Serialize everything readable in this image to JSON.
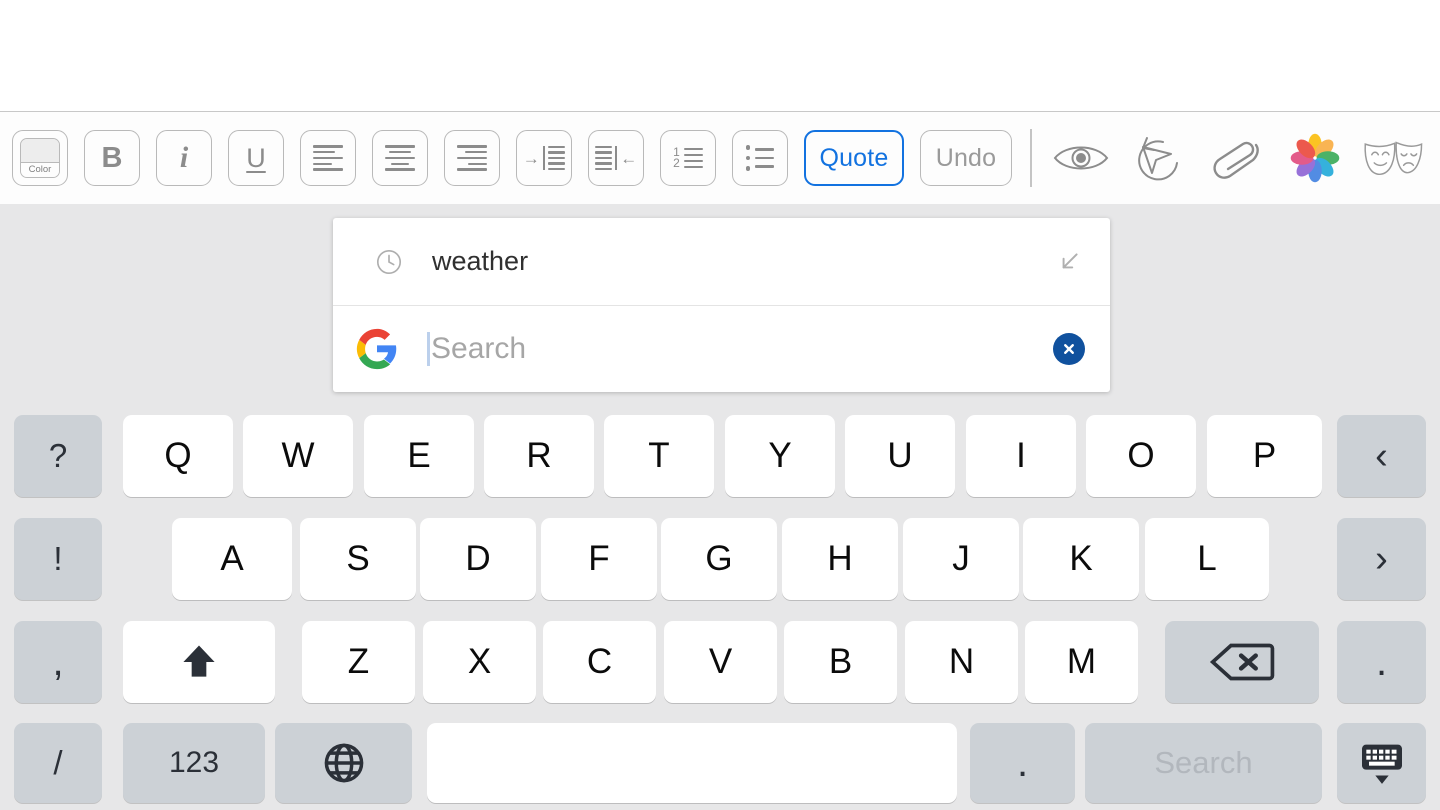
{
  "app": {
    "context": "ios-mail-compose-with-google-search-keyboard"
  },
  "compose": {
    "body_text": ""
  },
  "toolbar": {
    "color_button": {
      "label": "Color",
      "name": "color-picker"
    },
    "buttons": [
      {
        "id": "bold",
        "label": "B",
        "name": "bold-button"
      },
      {
        "id": "italic",
        "label": "i",
        "name": "italic-button"
      },
      {
        "id": "underline",
        "label": "U",
        "name": "underline-button"
      },
      {
        "id": "align-left",
        "label": "",
        "name": "align-left-button"
      },
      {
        "id": "align-center",
        "label": "",
        "name": "align-center-button"
      },
      {
        "id": "align-right",
        "label": "",
        "name": "align-right-button"
      },
      {
        "id": "indent",
        "label": "",
        "name": "indent-button"
      },
      {
        "id": "outdent",
        "label": "",
        "name": "outdent-button"
      },
      {
        "id": "numbered-list",
        "label": "1 2",
        "name": "numbered-list-button"
      },
      {
        "id": "bulleted-list",
        "label": "",
        "name": "bulleted-list-button"
      }
    ],
    "quote_label": "Quote",
    "undo_label": "Undo",
    "quote_accent_color": "#1272e0",
    "undo_color": "#9a9a9a",
    "icons": [
      {
        "id": "preview",
        "name": "eye-icon"
      },
      {
        "id": "undo-send",
        "name": "undo-send-icon"
      },
      {
        "id": "attach",
        "name": "paperclip-icon"
      },
      {
        "id": "photos",
        "name": "photos-app-icon"
      },
      {
        "id": "markup",
        "name": "theater-masks-icon"
      }
    ]
  },
  "search_popup": {
    "suggestion": {
      "text": "weather",
      "leading_icon": "clock-icon",
      "trailing_icon": "arrow-down-left-icon"
    },
    "search_field": {
      "value": "",
      "placeholder": "Search",
      "leading_icon": "google-g-icon",
      "clear_icon": "clear-circle-icon",
      "clear_color": "#10519e"
    }
  },
  "keyboard": {
    "row1": [
      {
        "label": "?",
        "name": "key-question-mark",
        "style": "alt"
      },
      {
        "label": "Q",
        "name": "key-q",
        "style": "letter"
      },
      {
        "label": "W",
        "name": "key-w",
        "style": "letter"
      },
      {
        "label": "E",
        "name": "key-e",
        "style": "letter"
      },
      {
        "label": "R",
        "name": "key-r",
        "style": "letter"
      },
      {
        "label": "T",
        "name": "key-t",
        "style": "letter"
      },
      {
        "label": "Y",
        "name": "key-y",
        "style": "letter"
      },
      {
        "label": "U",
        "name": "key-u",
        "style": "letter"
      },
      {
        "label": "I",
        "name": "key-i",
        "style": "letter"
      },
      {
        "label": "O",
        "name": "key-o",
        "style": "letter"
      },
      {
        "label": "P",
        "name": "key-p",
        "style": "letter"
      },
      {
        "label": "‹",
        "name": "key-chevron-left",
        "style": "alt"
      }
    ],
    "row2": [
      {
        "label": "!",
        "name": "key-exclamation-mark",
        "style": "alt"
      },
      {
        "label": "A",
        "name": "key-a",
        "style": "letter"
      },
      {
        "label": "S",
        "name": "key-s",
        "style": "letter"
      },
      {
        "label": "D",
        "name": "key-d",
        "style": "letter"
      },
      {
        "label": "F",
        "name": "key-f",
        "style": "letter"
      },
      {
        "label": "G",
        "name": "key-g",
        "style": "letter"
      },
      {
        "label": "H",
        "name": "key-h",
        "style": "letter"
      },
      {
        "label": "J",
        "name": "key-j",
        "style": "letter"
      },
      {
        "label": "K",
        "name": "key-k",
        "style": "letter"
      },
      {
        "label": "L",
        "name": "key-l",
        "style": "letter"
      },
      {
        "label": "›",
        "name": "key-chevron-right",
        "style": "alt"
      }
    ],
    "row3": [
      {
        "label": ",",
        "name": "key-comma",
        "style": "alt"
      },
      {
        "label": "",
        "name": "key-shift",
        "style": "shift"
      },
      {
        "label": "Z",
        "name": "key-z",
        "style": "letter"
      },
      {
        "label": "X",
        "name": "key-x",
        "style": "letter"
      },
      {
        "label": "C",
        "name": "key-c",
        "style": "letter"
      },
      {
        "label": "V",
        "name": "key-v",
        "style": "letter"
      },
      {
        "label": "B",
        "name": "key-b",
        "style": "letter"
      },
      {
        "label": "N",
        "name": "key-n",
        "style": "letter"
      },
      {
        "label": "M",
        "name": "key-m",
        "style": "letter"
      },
      {
        "label": "",
        "name": "key-backspace",
        "style": "backspace"
      },
      {
        "label": ".",
        "name": "key-period-right",
        "style": "alt"
      }
    ],
    "row4": [
      {
        "label": "/",
        "name": "key-slash",
        "style": "alt"
      },
      {
        "label": "123",
        "name": "key-numbers",
        "style": "alt"
      },
      {
        "label": "",
        "name": "key-globe",
        "style": "globe"
      },
      {
        "label": "",
        "name": "key-space",
        "style": "space"
      },
      {
        "label": ".",
        "name": "key-period",
        "style": "alt"
      },
      {
        "label": "Search",
        "name": "key-search",
        "style": "dim"
      },
      {
        "label": "",
        "name": "key-dismiss-keyboard",
        "style": "dismiss"
      }
    ]
  }
}
